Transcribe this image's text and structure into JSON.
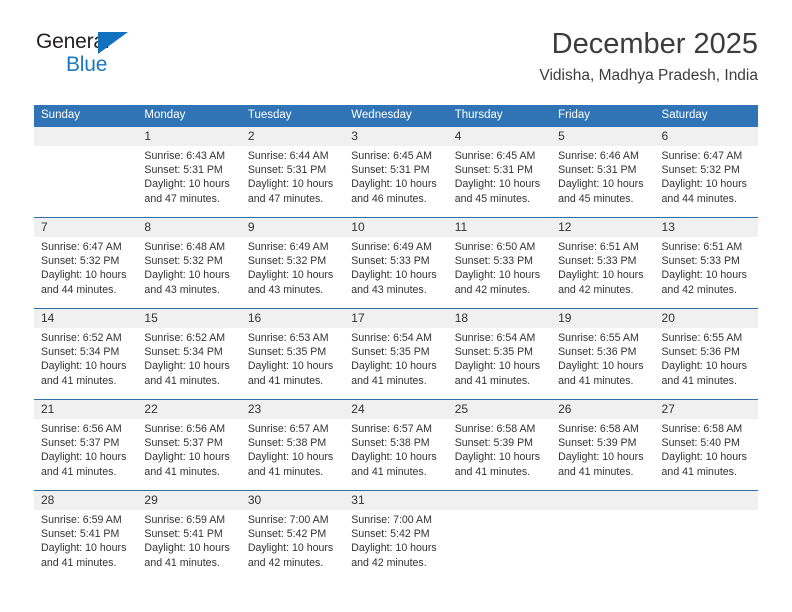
{
  "brand": {
    "name_part1": "General",
    "name_part2": "Blue"
  },
  "header": {
    "title": "December 2025",
    "location": "Vidisha, Madhya Pradesh, India"
  },
  "colors": {
    "header_blue": "#3174b6",
    "row_divider_blue": "#2f6fad",
    "daynum_band": "#f0f0f0",
    "brand_blue": "#1b78c2",
    "text": "#333333"
  },
  "weekday_headers": [
    "Sunday",
    "Monday",
    "Tuesday",
    "Wednesday",
    "Thursday",
    "Friday",
    "Saturday"
  ],
  "weeks": [
    {
      "days": [
        {
          "num": "",
          "sunrise": "",
          "sunset": "",
          "daylight1": "",
          "daylight2": ""
        },
        {
          "num": "1",
          "sunrise": "Sunrise: 6:43 AM",
          "sunset": "Sunset: 5:31 PM",
          "daylight1": "Daylight: 10 hours",
          "daylight2": "and 47 minutes."
        },
        {
          "num": "2",
          "sunrise": "Sunrise: 6:44 AM",
          "sunset": "Sunset: 5:31 PM",
          "daylight1": "Daylight: 10 hours",
          "daylight2": "and 47 minutes."
        },
        {
          "num": "3",
          "sunrise": "Sunrise: 6:45 AM",
          "sunset": "Sunset: 5:31 PM",
          "daylight1": "Daylight: 10 hours",
          "daylight2": "and 46 minutes."
        },
        {
          "num": "4",
          "sunrise": "Sunrise: 6:45 AM",
          "sunset": "Sunset: 5:31 PM",
          "daylight1": "Daylight: 10 hours",
          "daylight2": "and 45 minutes."
        },
        {
          "num": "5",
          "sunrise": "Sunrise: 6:46 AM",
          "sunset": "Sunset: 5:31 PM",
          "daylight1": "Daylight: 10 hours",
          "daylight2": "and 45 minutes."
        },
        {
          "num": "6",
          "sunrise": "Sunrise: 6:47 AM",
          "sunset": "Sunset: 5:32 PM",
          "daylight1": "Daylight: 10 hours",
          "daylight2": "and 44 minutes."
        }
      ]
    },
    {
      "days": [
        {
          "num": "7",
          "sunrise": "Sunrise: 6:47 AM",
          "sunset": "Sunset: 5:32 PM",
          "daylight1": "Daylight: 10 hours",
          "daylight2": "and 44 minutes."
        },
        {
          "num": "8",
          "sunrise": "Sunrise: 6:48 AM",
          "sunset": "Sunset: 5:32 PM",
          "daylight1": "Daylight: 10 hours",
          "daylight2": "and 43 minutes."
        },
        {
          "num": "9",
          "sunrise": "Sunrise: 6:49 AM",
          "sunset": "Sunset: 5:32 PM",
          "daylight1": "Daylight: 10 hours",
          "daylight2": "and 43 minutes."
        },
        {
          "num": "10",
          "sunrise": "Sunrise: 6:49 AM",
          "sunset": "Sunset: 5:33 PM",
          "daylight1": "Daylight: 10 hours",
          "daylight2": "and 43 minutes."
        },
        {
          "num": "11",
          "sunrise": "Sunrise: 6:50 AM",
          "sunset": "Sunset: 5:33 PM",
          "daylight1": "Daylight: 10 hours",
          "daylight2": "and 42 minutes."
        },
        {
          "num": "12",
          "sunrise": "Sunrise: 6:51 AM",
          "sunset": "Sunset: 5:33 PM",
          "daylight1": "Daylight: 10 hours",
          "daylight2": "and 42 minutes."
        },
        {
          "num": "13",
          "sunrise": "Sunrise: 6:51 AM",
          "sunset": "Sunset: 5:33 PM",
          "daylight1": "Daylight: 10 hours",
          "daylight2": "and 42 minutes."
        }
      ]
    },
    {
      "days": [
        {
          "num": "14",
          "sunrise": "Sunrise: 6:52 AM",
          "sunset": "Sunset: 5:34 PM",
          "daylight1": "Daylight: 10 hours",
          "daylight2": "and 41 minutes."
        },
        {
          "num": "15",
          "sunrise": "Sunrise: 6:52 AM",
          "sunset": "Sunset: 5:34 PM",
          "daylight1": "Daylight: 10 hours",
          "daylight2": "and 41 minutes."
        },
        {
          "num": "16",
          "sunrise": "Sunrise: 6:53 AM",
          "sunset": "Sunset: 5:35 PM",
          "daylight1": "Daylight: 10 hours",
          "daylight2": "and 41 minutes."
        },
        {
          "num": "17",
          "sunrise": "Sunrise: 6:54 AM",
          "sunset": "Sunset: 5:35 PM",
          "daylight1": "Daylight: 10 hours",
          "daylight2": "and 41 minutes."
        },
        {
          "num": "18",
          "sunrise": "Sunrise: 6:54 AM",
          "sunset": "Sunset: 5:35 PM",
          "daylight1": "Daylight: 10 hours",
          "daylight2": "and 41 minutes."
        },
        {
          "num": "19",
          "sunrise": "Sunrise: 6:55 AM",
          "sunset": "Sunset: 5:36 PM",
          "daylight1": "Daylight: 10 hours",
          "daylight2": "and 41 minutes."
        },
        {
          "num": "20",
          "sunrise": "Sunrise: 6:55 AM",
          "sunset": "Sunset: 5:36 PM",
          "daylight1": "Daylight: 10 hours",
          "daylight2": "and 41 minutes."
        }
      ]
    },
    {
      "days": [
        {
          "num": "21",
          "sunrise": "Sunrise: 6:56 AM",
          "sunset": "Sunset: 5:37 PM",
          "daylight1": "Daylight: 10 hours",
          "daylight2": "and 41 minutes."
        },
        {
          "num": "22",
          "sunrise": "Sunrise: 6:56 AM",
          "sunset": "Sunset: 5:37 PM",
          "daylight1": "Daylight: 10 hours",
          "daylight2": "and 41 minutes."
        },
        {
          "num": "23",
          "sunrise": "Sunrise: 6:57 AM",
          "sunset": "Sunset: 5:38 PM",
          "daylight1": "Daylight: 10 hours",
          "daylight2": "and 41 minutes."
        },
        {
          "num": "24",
          "sunrise": "Sunrise: 6:57 AM",
          "sunset": "Sunset: 5:38 PM",
          "daylight1": "Daylight: 10 hours",
          "daylight2": "and 41 minutes."
        },
        {
          "num": "25",
          "sunrise": "Sunrise: 6:58 AM",
          "sunset": "Sunset: 5:39 PM",
          "daylight1": "Daylight: 10 hours",
          "daylight2": "and 41 minutes."
        },
        {
          "num": "26",
          "sunrise": "Sunrise: 6:58 AM",
          "sunset": "Sunset: 5:39 PM",
          "daylight1": "Daylight: 10 hours",
          "daylight2": "and 41 minutes."
        },
        {
          "num": "27",
          "sunrise": "Sunrise: 6:58 AM",
          "sunset": "Sunset: 5:40 PM",
          "daylight1": "Daylight: 10 hours",
          "daylight2": "and 41 minutes."
        }
      ]
    },
    {
      "days": [
        {
          "num": "28",
          "sunrise": "Sunrise: 6:59 AM",
          "sunset": "Sunset: 5:41 PM",
          "daylight1": "Daylight: 10 hours",
          "daylight2": "and 41 minutes."
        },
        {
          "num": "29",
          "sunrise": "Sunrise: 6:59 AM",
          "sunset": "Sunset: 5:41 PM",
          "daylight1": "Daylight: 10 hours",
          "daylight2": "and 41 minutes."
        },
        {
          "num": "30",
          "sunrise": "Sunrise: 7:00 AM",
          "sunset": "Sunset: 5:42 PM",
          "daylight1": "Daylight: 10 hours",
          "daylight2": "and 42 minutes."
        },
        {
          "num": "31",
          "sunrise": "Sunrise: 7:00 AM",
          "sunset": "Sunset: 5:42 PM",
          "daylight1": "Daylight: 10 hours",
          "daylight2": "and 42 minutes."
        },
        {
          "num": "",
          "sunrise": "",
          "sunset": "",
          "daylight1": "",
          "daylight2": ""
        },
        {
          "num": "",
          "sunrise": "",
          "sunset": "",
          "daylight1": "",
          "daylight2": ""
        },
        {
          "num": "",
          "sunrise": "",
          "sunset": "",
          "daylight1": "",
          "daylight2": ""
        }
      ]
    }
  ]
}
